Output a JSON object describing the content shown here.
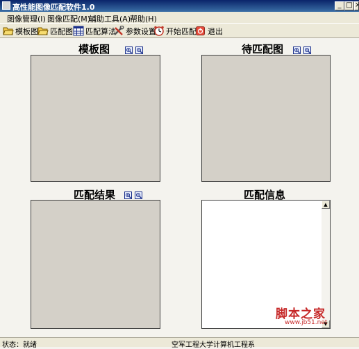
{
  "window": {
    "title": "高性能图像匹配软件1.0",
    "controls": {
      "minimize": "_",
      "maximize": "□",
      "close": "×"
    }
  },
  "menu": [
    "图像管理(I)",
    "图像匹配(M)",
    "辅助工具(A)",
    "帮助(H)"
  ],
  "toolbar": [
    {
      "label": "模板图",
      "icon": "open-folder-icon"
    },
    {
      "label": "匹配图",
      "icon": "open-folder-icon"
    },
    {
      "label": "匹配算法",
      "icon": "grid-icon"
    },
    {
      "label": "参数设置",
      "icon": "tools-icon"
    },
    {
      "label": "开始匹配",
      "icon": "alarm-clock-icon"
    },
    {
      "label": "退出",
      "icon": "exit-icon"
    }
  ],
  "panels": {
    "template": {
      "title": "模板图"
    },
    "to_match": {
      "title": "待匹配图"
    },
    "result": {
      "title": "匹配结果"
    },
    "info": {
      "title": "匹配信息",
      "text": ""
    }
  },
  "zoom_icons": [
    "zoom-in-icon",
    "zoom-out-icon"
  ],
  "status": {
    "left": "状态：就绪",
    "right": "空军工程大学计算机工程系"
  },
  "watermark": {
    "text": "脚本之家",
    "url": "www.jb51.net"
  },
  "colors": {
    "titlebar": "#0a246a",
    "panel": "#d4d0c8",
    "background": "#f4f3ee",
    "watermark": "#c62828"
  }
}
